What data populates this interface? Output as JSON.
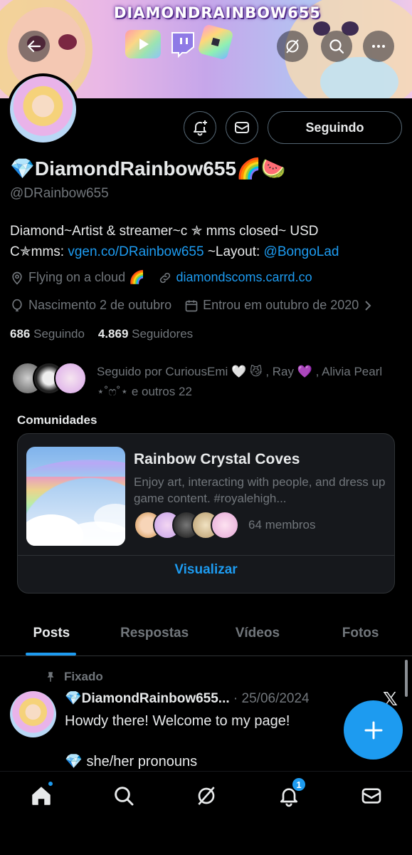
{
  "banner": {
    "title": "DIAMONDRAINBOW655"
  },
  "profile": {
    "display_name": "💎DiamondRainbow655🌈🍉",
    "handle": "@DRainbow655",
    "bio_line1": "Diamond~Artist & streamer~c ✯ mms closed~ USD",
    "bio_line2_pre": "C✯mms: ",
    "bio_link1": "vgen.co/DRainbow655",
    "bio_line2_mid": " ~Layout: ",
    "bio_link2": "@BongoLad",
    "location": "Flying on a cloud 🌈",
    "website": "diamondscoms.carrd.co",
    "birthday": "Nascimento 2 de outubro",
    "joined": "Entrou em outubro de 2020",
    "following_count": "686",
    "following_label": "Seguindo",
    "followers_count": "4.869",
    "followers_label": "Seguidores",
    "followed_by": "Seguido por CuriousEmi 🤍 😼 , Ray 💜 , Alivia Pearl ⋆˚ෆ˚⋆ e outros 22"
  },
  "actions": {
    "follow_label": "Seguindo"
  },
  "communities": {
    "title": "Comunidades",
    "name": "Rainbow Crystal Coves",
    "description": "Enjoy art, interacting with people, and dress up game content. #royalehigh...",
    "members": "64 membros",
    "view_label": "Visualizar"
  },
  "tabs": [
    {
      "label": "Posts",
      "active": true
    },
    {
      "label": "Respostas",
      "active": false
    },
    {
      "label": "Vídeos",
      "active": false
    },
    {
      "label": "Fotos",
      "active": false
    }
  ],
  "pinned_post": {
    "pinned_label": "Fixado",
    "author": "💎DiamondRainbow655...",
    "separator": " · ",
    "date": "25/06/2024",
    "text": "Howdy there! Welcome to my page!",
    "text2": "💎 she/her pronouns"
  },
  "nav": {
    "notifications_badge": "1"
  },
  "colors": {
    "accent": "#1d9bf0",
    "background": "#000000",
    "muted": "#71767b"
  }
}
